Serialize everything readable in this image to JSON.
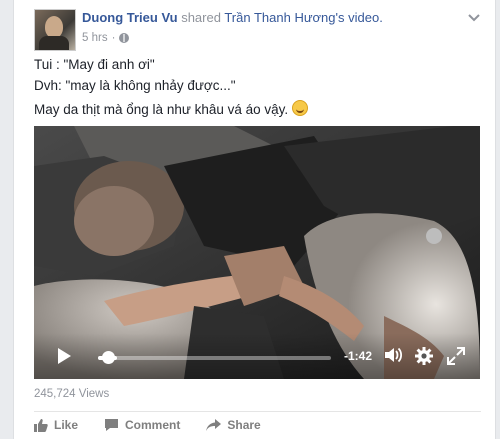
{
  "post": {
    "author": "Duong Trieu Vu",
    "shared_text": "shared",
    "source_name": "Trần Thanh Hương",
    "source_suffix": "'s video.",
    "time": "5 hrs",
    "lines": [
      "Tui : \"May đi anh ơi\"",
      "Dvh: \"may là không nhảy được...\"",
      "May da thịt mà ổng là như khâu vá áo vậy."
    ],
    "emoji": "grin-emoji"
  },
  "video": {
    "remaining_time": "-1:42",
    "progress": 0.08,
    "icons": [
      "play-icon",
      "volume-icon",
      "settings-icon",
      "fullscreen-icon"
    ]
  },
  "stats": {
    "views": "245,724 Views"
  },
  "actions": {
    "like": "Like",
    "comment": "Comment",
    "share": "Share"
  },
  "colors": {
    "link": "#365899",
    "meta": "#90949c",
    "text": "#1d2129",
    "action": "#7f7f7f"
  }
}
